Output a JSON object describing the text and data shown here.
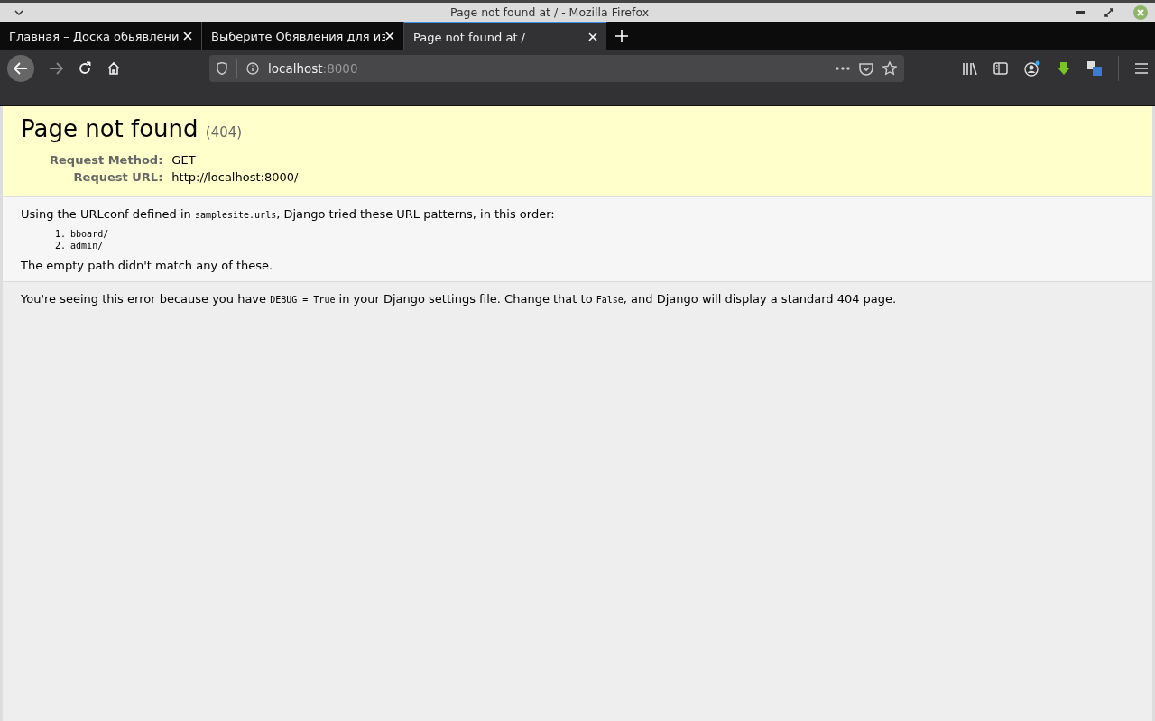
{
  "window": {
    "title": "Page not found at / - Mozilla Firefox"
  },
  "tabs": [
    {
      "label": "Главная – Доска обьявлени",
      "selected": false
    },
    {
      "label": "Выберите Обявления для из",
      "selected": false
    },
    {
      "label": "Page not found at /",
      "selected": true
    }
  ],
  "address_bar": {
    "host": "localhost",
    "port": ":8000"
  },
  "page": {
    "title": "Page not found",
    "code": "(404)",
    "request": [
      {
        "label": "Request Method:",
        "value": "GET"
      },
      {
        "label": "Request URL:",
        "value": "http://localhost:8000/"
      }
    ],
    "intro": [
      {
        "kind": "text",
        "text": "Using the URLconf defined in "
      },
      {
        "kind": "code",
        "text": "samplesite.urls"
      },
      {
        "kind": "text",
        "text": ", Django tried these URL patterns, in this order:"
      }
    ],
    "patterns": [
      {
        "number": "1.",
        "pattern": "bboard/"
      },
      {
        "number": "2.",
        "pattern": "admin/"
      }
    ],
    "no_match": "The empty path didn't match any of these.",
    "explanation": [
      {
        "kind": "text",
        "text": "You're seeing this error because you have "
      },
      {
        "kind": "code",
        "text": "DEBUG = True"
      },
      {
        "kind": "text",
        "text": " in your Django settings file. Change that to "
      },
      {
        "kind": "code",
        "text": "False"
      },
      {
        "kind": "text",
        "text": ", and Django will display a standard 404 page."
      }
    ]
  }
}
